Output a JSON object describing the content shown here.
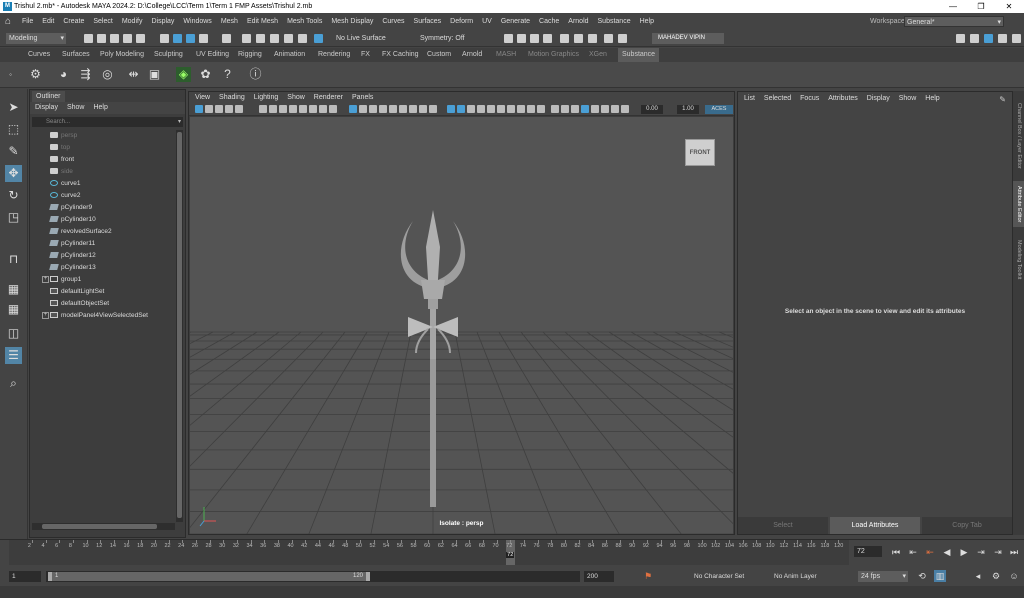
{
  "window": {
    "title": "Trishul 2.mb* - Autodesk MAYA 2024.2: D:\\College\\LCC\\Term 1\\Term 1 FMP Assets\\Trishul 2.mb",
    "minimize": "—",
    "maximize": "❐",
    "close": "✕"
  },
  "menubar": {
    "items": [
      "File",
      "Edit",
      "Create",
      "Select",
      "Modify",
      "Display",
      "Windows",
      "Mesh",
      "Edit Mesh",
      "Mesh Tools",
      "Mesh Display",
      "Curves",
      "Surfaces",
      "Deform",
      "UV",
      "Generate",
      "Cache",
      "Arnold",
      "Substance",
      "Help"
    ],
    "workspace_label": "Workspace:",
    "workspace_value": "General*"
  },
  "statusline": {
    "mode": "Modeling",
    "live_surface": "No Live Surface",
    "symmetry": "Symmetry: Off",
    "user": "MAHADEV VIPIN"
  },
  "shelf": {
    "tabs": [
      "Curves",
      "Surfaces",
      "Poly Modeling",
      "Sculpting",
      "UV Editing",
      "Rigging",
      "Animation",
      "Rendering",
      "FX",
      "FX Caching",
      "Custom",
      "Arnold",
      "MASH",
      "Motion Graphics",
      "XGen",
      "Substance"
    ],
    "active_tab": "Substance"
  },
  "outliner": {
    "tab_label": "Outliner",
    "menu": [
      "Display",
      "Show",
      "Help"
    ],
    "search_placeholder": "Search...",
    "items": [
      {
        "label": "persp",
        "icon": "camera-icon",
        "dim": true
      },
      {
        "label": "top",
        "icon": "camera-icon",
        "dim": true
      },
      {
        "label": "front",
        "icon": "camera-icon",
        "dim": false
      },
      {
        "label": "side",
        "icon": "camera-icon",
        "dim": true
      },
      {
        "label": "curve1",
        "icon": "curve-icon",
        "dim": false
      },
      {
        "label": "curve2",
        "icon": "curve-icon",
        "dim": false
      },
      {
        "label": "pCylinder9",
        "icon": "mesh-icon",
        "dim": false
      },
      {
        "label": "pCylinder10",
        "icon": "mesh-icon",
        "dim": false
      },
      {
        "label": "revolvedSurface2",
        "icon": "mesh-icon",
        "dim": false
      },
      {
        "label": "pCylinder11",
        "icon": "mesh-icon",
        "dim": false
      },
      {
        "label": "pCylinder12",
        "icon": "mesh-icon",
        "dim": false
      },
      {
        "label": "pCylinder13",
        "icon": "mesh-icon",
        "dim": false
      },
      {
        "label": "group1",
        "icon": "group-icon",
        "dim": false
      },
      {
        "label": "defaultLightSet",
        "icon": "set-icon",
        "dim": false
      },
      {
        "label": "defaultObjectSet",
        "icon": "set-icon",
        "dim": false
      },
      {
        "label": "modelPanel4ViewSelectedSet",
        "icon": "set-icon",
        "dim": false
      }
    ]
  },
  "viewport": {
    "menu": [
      "View",
      "Shading",
      "Lighting",
      "Show",
      "Renderer",
      "Panels"
    ],
    "exposure": "0.00",
    "gamma": "1.00",
    "color_space": "ACES",
    "view_cube_label": "FRONT",
    "isolate_label": "Isolate : persp"
  },
  "attribute_editor": {
    "menu": [
      "List",
      "Selected",
      "Focus",
      "Attributes",
      "Display",
      "Show",
      "Help"
    ],
    "message": "Select an object in the scene to view and edit its attributes",
    "buttons": {
      "select": "Select",
      "load": "Load Attributes",
      "copy": "Copy Tab"
    }
  },
  "side_tabs": [
    "Channel Box / Layer Editor",
    "Attribute Editor",
    "Modeling Toolkit"
  ],
  "timeline": {
    "ticks": [
      2,
      4,
      6,
      8,
      10,
      12,
      14,
      16,
      18,
      20,
      22,
      24,
      26,
      28,
      30,
      32,
      34,
      36,
      38,
      40,
      42,
      44,
      46,
      48,
      50,
      52,
      54,
      56,
      58,
      60,
      62,
      64,
      66,
      68,
      70,
      72,
      74,
      76,
      78,
      80,
      82,
      84,
      86,
      88,
      90,
      92,
      94,
      96,
      98,
      100,
      102,
      104,
      106,
      108,
      110,
      112,
      114,
      116,
      118,
      120
    ],
    "current_frame": "72",
    "current_frame_field": "72"
  },
  "range": {
    "start": "1",
    "inner_start": "1",
    "inner_end": "120",
    "end": "200",
    "character_set": "No Character Set",
    "anim_layer": "No Anim Layer",
    "fps": "24 fps"
  },
  "colors": {
    "accent": "#4a9fd5",
    "maya_blue": "#1a7fb5"
  }
}
